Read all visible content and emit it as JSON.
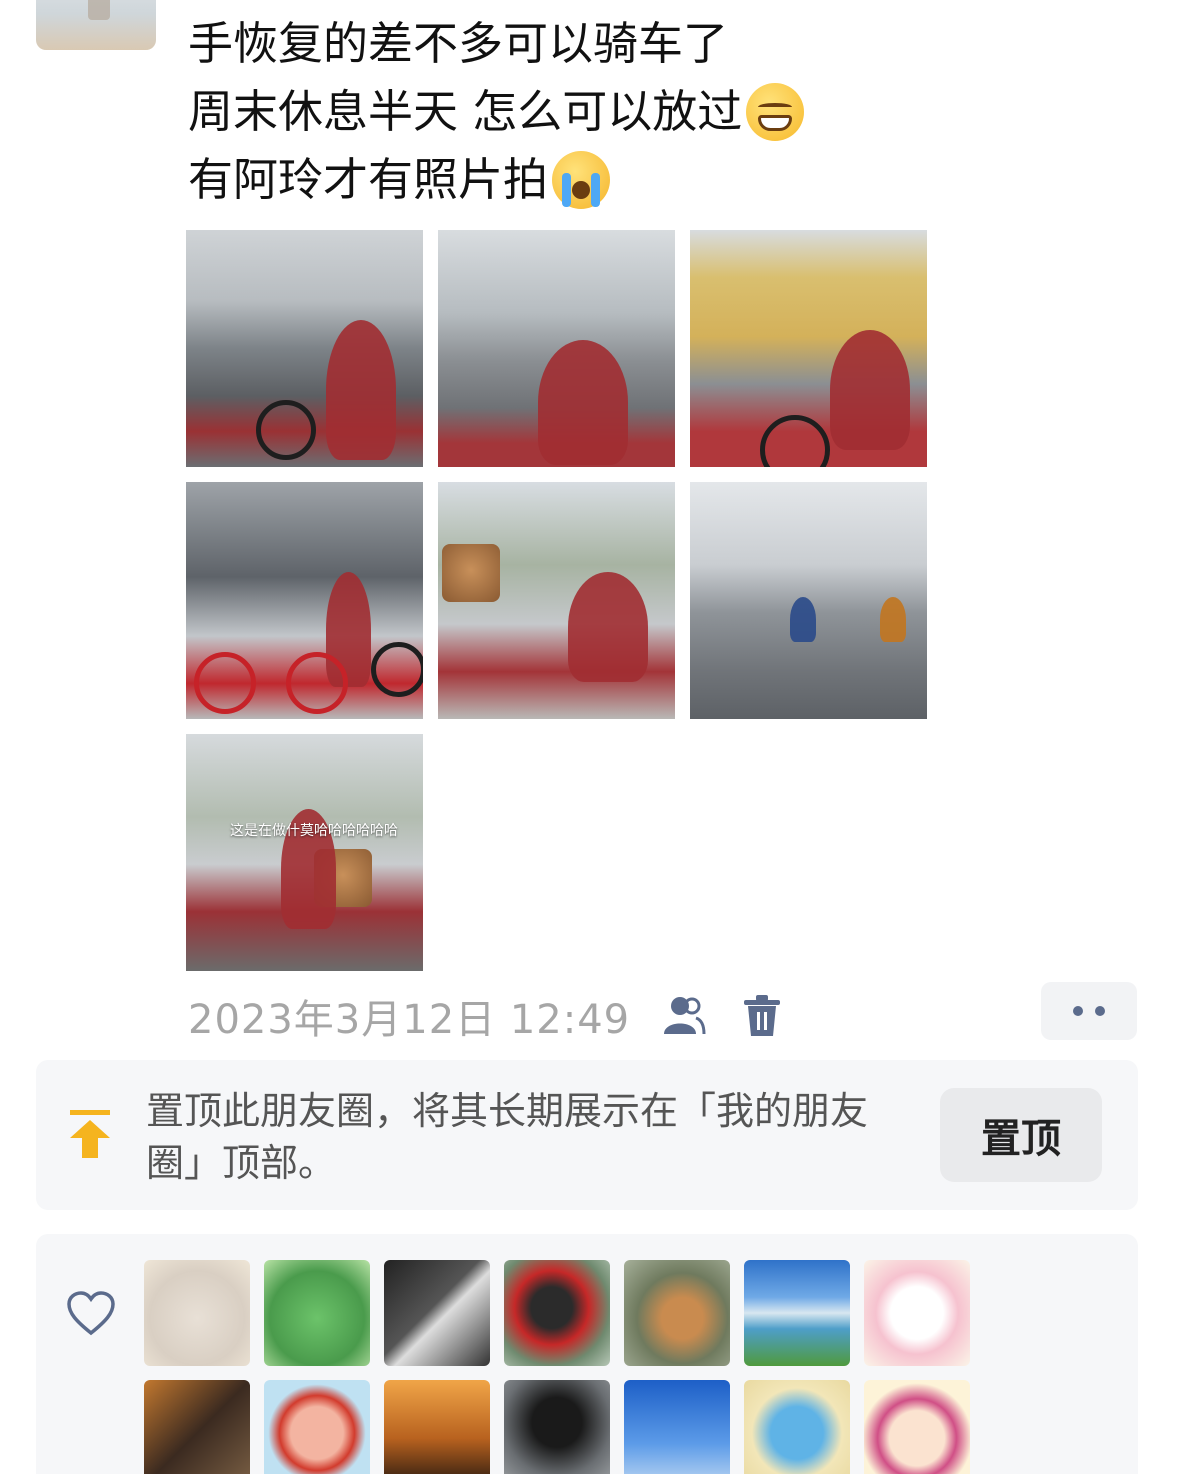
{
  "post": {
    "lines": [
      "手恢复的差不多可以骑车了",
      "周末休息半天 怎么可以放过",
      "有阿玲才有照片拍"
    ],
    "emoji_line2": "grinning-face-emoji",
    "emoji_line3": "loudly-crying-face-emoji",
    "photo_overlay_text": "这是在做什莫哈哈哈哈哈哈"
  },
  "meta": {
    "timestamp": "2023年3月12日 12:49",
    "visibility_icon": "people-icon",
    "delete_icon": "trash-icon",
    "more_icon": "more-dots-icon"
  },
  "pin": {
    "icon": "pin-to-top-icon",
    "text": "置顶此朋友圈，将其长期展示在「我的朋友圈」顶部。",
    "button_label": "置顶"
  },
  "likes": {
    "icon": "heart-icon",
    "avatars": [
      "cartoon-cat-avatar",
      "green-monster-avatar",
      "racer-avatar",
      "mickey-avatar",
      "cat-photo-avatar",
      "landscape-avatar",
      "hello-kitty-avatar",
      "portrait-avatar",
      "glasses-cartoon-avatar",
      "sunset-avatar",
      "motorcycle-avatar",
      "blue-sky-avatar",
      "blue-cat-avatar",
      "pink-hair-cartoon-avatar"
    ]
  },
  "colors": {
    "accent_yellow": "#f5b41f",
    "link_blue": "#5b6b8c",
    "timestamp_gray": "#a6a6a6"
  }
}
